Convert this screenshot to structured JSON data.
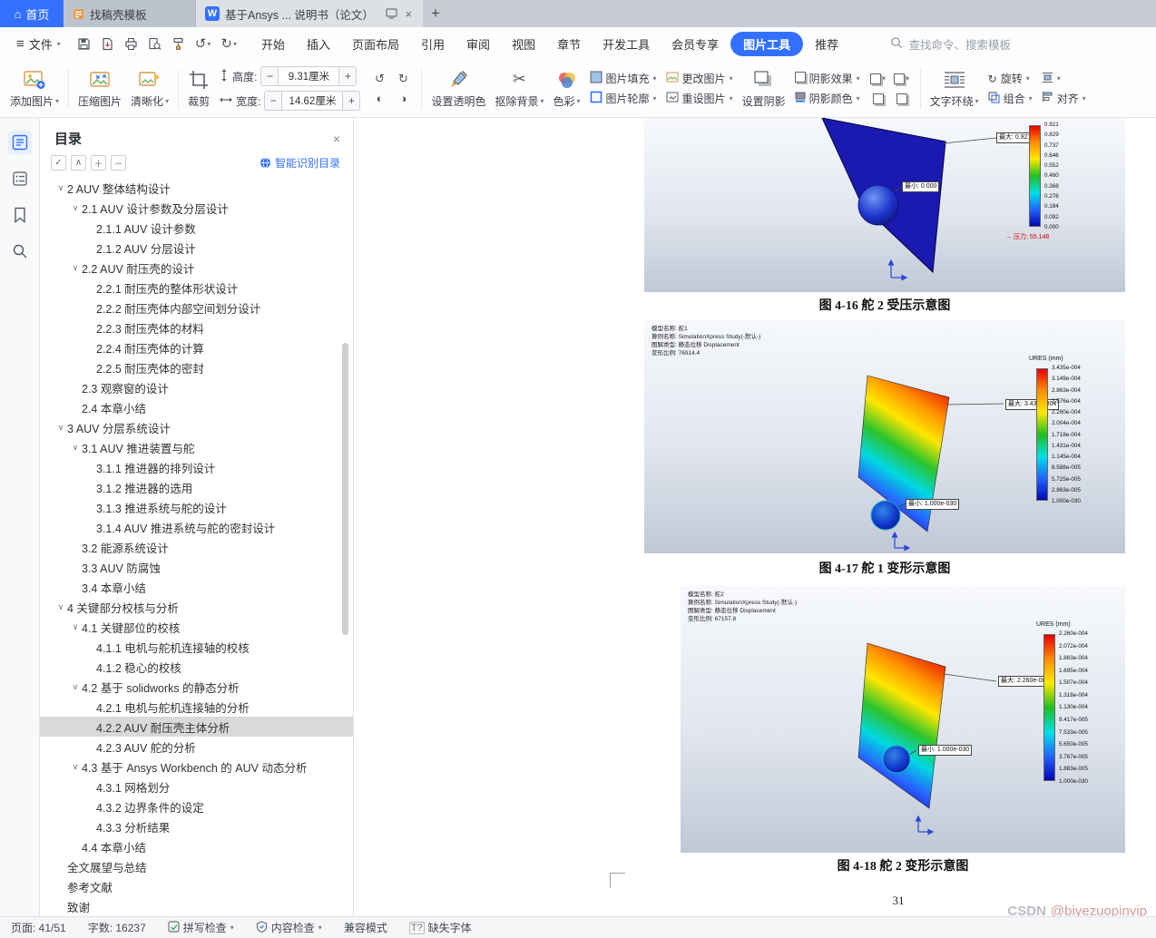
{
  "icons": {
    "hamburger": "≡",
    "caret": "▾",
    "chevron_down": "∨",
    "close": "×",
    "home": "⌂",
    "writer": "W",
    "plus": "+",
    "minus": "−",
    "undo": "↺",
    "redo": "↻",
    "brightness_up": "◐",
    "brightness_down": "◑",
    "scissors": "✂",
    "check": "✓",
    "expand": "∧",
    "collapse_plus": "＋",
    "collapse_minus": "－",
    "arrow_right": "→",
    "missing_font": "T?"
  },
  "tabbar": {
    "home": "首页",
    "tab2": "找稿壳模板",
    "doc_tab": "基于Ansys ... 说明书（论文）",
    "new_tab": "+"
  },
  "menubar": {
    "file": "文件",
    "items": [
      "开始",
      "插入",
      "页面布局",
      "引用",
      "审阅",
      "视图",
      "章节",
      "开发工具",
      "会员专享",
      "图片工具",
      "推荐"
    ],
    "active_item": "图片工具",
    "search_placeholder": "查找命令、搜索模板"
  },
  "ribbon": {
    "add_picture": "添加图片",
    "compress_picture": "压缩图片",
    "sharpen": "清晰化",
    "crop": "裁剪",
    "height_label": "高度:",
    "height_value": "9.31厘米",
    "width_label": "宽度:",
    "width_value": "14.62厘米",
    "set_transparent": "设置透明色",
    "remove_background": "抠除背景",
    "color": "色彩",
    "picture_fill": "图片填充",
    "picture_outline": "图片轮廓",
    "change_picture": "更改图片",
    "reset_picture": "重设图片",
    "set_shadow": "设置阴影",
    "shadow_effect": "阴影效果",
    "shadow_color": "阴影颜色",
    "text_wrap": "文字环绕",
    "rotate": "旋转",
    "group": "组合",
    "align": "对齐"
  },
  "toc": {
    "title": "目录",
    "smart_recognize": "智能识别目录",
    "items": [
      "2 AUV 整体结构设计",
      "2.1 AUV 设计参数及分层设计",
      "2.1.1 AUV 设计参数",
      "2.1.2 AUV 分层设计",
      "2.2 AUV 耐压壳的设计",
      "2.2.1 耐压壳的整体形状设计",
      "2.2.2 耐压壳体内部空间划分设计",
      "2.2.3 耐压壳体的材料",
      "2.2.4 耐压壳体的计算",
      "2.2.5 耐压壳体的密封",
      "2.3 观察窗的设计",
      "2.4 本章小结",
      "3 AUV 分层系统设计",
      "3.1 AUV 推进装置与舵",
      "3.1.1 推进器的排列设计",
      "3.1.2 推进器的选用",
      "3.1.3 推进系统与舵的设计",
      "3.1.4 AUV 推进系统与舵的密封设计",
      "3.2 能源系统设计",
      "3.3 AUV 防腐蚀",
      "3.4 本章小结",
      "4 关键部分校核与分析",
      "4.1 关键部位的校核",
      "4.1.1 电机与舵机连接轴的校核",
      "4.1.2 稳心的校核",
      "4.2 基于 solidworks 的静态分析",
      "4.2.1 电机与舵机连接轴的分析",
      "4.2.2 AUV 耐压壳主体分析",
      "4.2.3 AUV 舵的分析",
      "4.3 基于 Ansys Workbench 的 AUV 动态分析",
      "4.3.1 网格划分",
      "4.3.2 边界条件的设定",
      "4.3.3 分析结果",
      "4.4 本章小结",
      "全文展望与总结",
      "参考文献",
      "致谢"
    ]
  },
  "figures": {
    "fig16": {
      "caption": "图 4-16 舵 2 受压示意图",
      "callout_max": "最大: 0.921",
      "callout_min": "最小: 0.000",
      "pressure_label": "压力: 55.148",
      "colorbar_values": [
        "0.921",
        "0.829",
        "0.737",
        "0.646",
        "0.552",
        "0.460",
        "0.368",
        "0.276",
        "0.184",
        "0.092",
        "0.000"
      ]
    },
    "fig17": {
      "caption": "图 4-17 舵 1 变形示意图",
      "info_lines": [
        "模型名称: 舵1",
        "算例名称: SimulationXpress Study(-默认-)",
        "图解类型: 静态位移 Displacement",
        "变形比例: 76914.4"
      ],
      "colorbar_title": "URES (mm)",
      "callout_max": "最大: 3.435e-004",
      "callout_min": "最小: 1.000e-030",
      "colorbar_values": [
        "3.435e-004",
        "3.149e-004",
        "2.863e-004",
        "2.576e-004",
        "2.290e-004",
        "2.004e-004",
        "1.718e-004",
        "1.431e-004",
        "1.145e-004",
        "8.588e-005",
        "5.725e-005",
        "2.863e-005",
        "1.000e-030"
      ]
    },
    "fig18": {
      "caption": "图 4-18 舵 2 变形示意图",
      "info_lines": [
        "模型名称: 舵2",
        "算例名称: SimulationXpress Study(-默认-)",
        "图解类型: 静态位移 Displacement",
        "变形比例: 67157.8"
      ],
      "colorbar_title": "URES (mm)",
      "callout_max": "最大: 2.260e-004",
      "callout_min": "最小: 1.000e-030",
      "colorbar_values": [
        "2.260e-004",
        "2.072e-004",
        "1.883e-004",
        "1.695e-004",
        "1.507e-004",
        "1.318e-004",
        "1.130e-004",
        "9.417e-005",
        "7.533e-005",
        "5.650e-005",
        "3.767e-005",
        "1.883e-005",
        "1.000e-030"
      ]
    }
  },
  "page": {
    "number": "31",
    "watermark_brand": "CSDN",
    "watermark_handle": "@biyezuopinvip"
  },
  "statusbar": {
    "page_info": "页面: 41/51",
    "word_count": "字数: 16237",
    "spell_check": "拼写检查",
    "content_check": "内容检查",
    "compat_mode": "兼容模式",
    "missing_font": "缺失字体"
  }
}
